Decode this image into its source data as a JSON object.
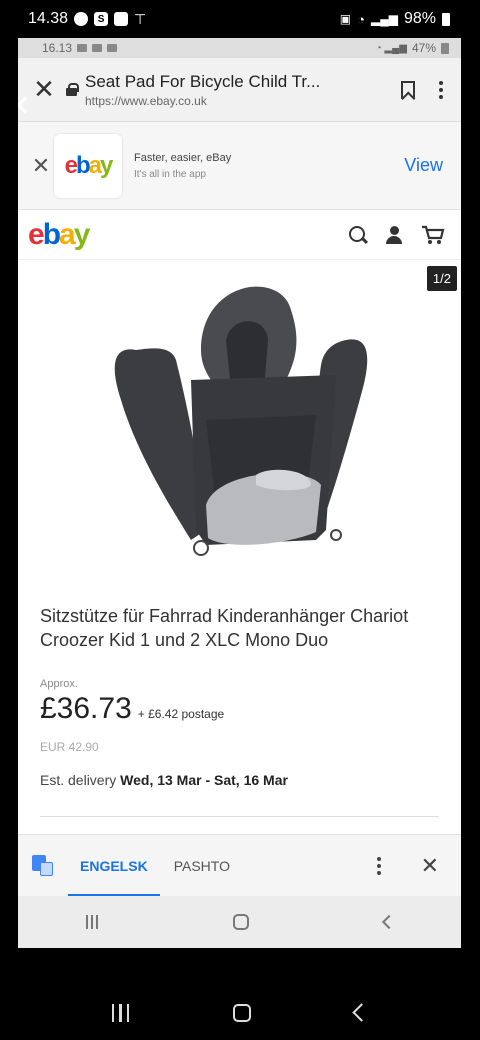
{
  "outer_status": {
    "time": "14.38",
    "battery": "98%"
  },
  "inner_status": {
    "time": "16.13",
    "battery": "47%"
  },
  "browser": {
    "page_title": "Seat Pad For Bicycle Child Tr...",
    "url": "https://www.ebay.co.uk"
  },
  "app_banner": {
    "line1": "Faster, easier, eBay",
    "line2": "It's all in the app",
    "view_label": "View"
  },
  "ebay_logo": {
    "e": "e",
    "b": "b",
    "a": "a",
    "y": "y"
  },
  "gallery": {
    "counter": "1/2"
  },
  "product": {
    "title": "Sitzstütze für Fahrrad Kinderanhänger Chariot Croozer Kid 1 und 2 XLC Mono Duo",
    "approx_label": "Approx.",
    "price": "£36.73",
    "postage": "+ £6.42 postage",
    "eur_price": "EUR 42.90",
    "delivery_label": "Est. delivery",
    "delivery_dates": "Wed, 13 Mar - Sat, 16 Mar"
  },
  "translate_bar": {
    "lang_active": "ENGELSK",
    "lang_other": "PASHTO"
  },
  "colors": {
    "ebay_red": "#e53238",
    "ebay_blue": "#0064d2",
    "ebay_yellow": "#f5af02",
    "ebay_green": "#86b817",
    "link_blue": "#1a73e8"
  },
  "icons": {
    "search": "search-icon",
    "account": "user-icon",
    "cart": "cart-icon",
    "translate": "translate-icon"
  }
}
